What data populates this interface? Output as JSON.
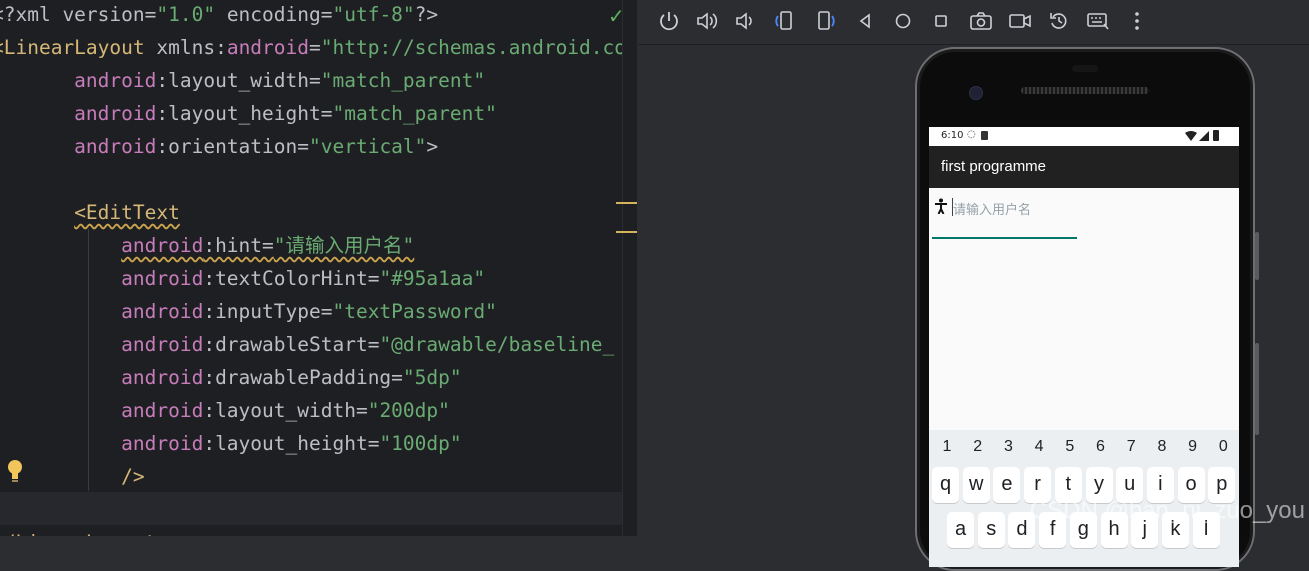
{
  "editor": {
    "lines": [
      [
        {
          "t": "<?xml version=",
          "c": "plain"
        },
        {
          "t": "\"1.0\"",
          "c": "str"
        },
        {
          "t": " encoding=",
          "c": "plain"
        },
        {
          "t": "\"utf-8\"",
          "c": "str"
        },
        {
          "t": "?>",
          "c": "plain"
        }
      ],
      [
        {
          "t": "<LinearLayout ",
          "c": "tag"
        },
        {
          "t": "xmlns:",
          "c": "plain"
        },
        {
          "t": "android",
          "c": "ns"
        },
        {
          "t": "=",
          "c": "plain"
        },
        {
          "t": "\"http://schemas.android.com/apk/res/android\"",
          "c": "str"
        }
      ],
      [
        {
          "t": "       android",
          "c": "ns"
        },
        {
          "t": ":layout_width=",
          "c": "plain"
        },
        {
          "t": "\"match_parent\"",
          "c": "str"
        }
      ],
      [
        {
          "t": "       android",
          "c": "ns"
        },
        {
          "t": ":layout_height=",
          "c": "plain"
        },
        {
          "t": "\"match_parent\"",
          "c": "str"
        }
      ],
      [
        {
          "t": "       android",
          "c": "ns"
        },
        {
          "t": ":orientation=",
          "c": "plain"
        },
        {
          "t": "\"vertical\"",
          "c": "str"
        },
        {
          "t": ">",
          "c": "plain"
        }
      ],
      [
        {
          "t": "",
          "c": "plain"
        }
      ],
      [
        {
          "t": "       <EditText",
          "c": "tag",
          "w": true
        }
      ],
      [
        {
          "t": "           android",
          "c": "ns",
          "w": true
        },
        {
          "t": ":hint=",
          "c": "plain",
          "w": true
        },
        {
          "t": "\"请输入用户名\"",
          "c": "str",
          "w": true
        }
      ],
      [
        {
          "t": "           android",
          "c": "ns"
        },
        {
          "t": ":textColorHint=",
          "c": "plain"
        },
        {
          "t": "\"#95a1aa\"",
          "c": "str"
        }
      ],
      [
        {
          "t": "           android",
          "c": "ns"
        },
        {
          "t": ":inputType=",
          "c": "plain"
        },
        {
          "t": "\"textPassword\"",
          "c": "str"
        }
      ],
      [
        {
          "t": "           android",
          "c": "ns"
        },
        {
          "t": ":drawableStart=",
          "c": "plain"
        },
        {
          "t": "\"@drawable/baseline_",
          "c": "str"
        }
      ],
      [
        {
          "t": "           android",
          "c": "ns"
        },
        {
          "t": ":drawablePadding=",
          "c": "plain"
        },
        {
          "t": "\"5dp\"",
          "c": "str"
        }
      ],
      [
        {
          "t": "           android",
          "c": "ns"
        },
        {
          "t": ":layout_width=",
          "c": "plain"
        },
        {
          "t": "\"200dp\"",
          "c": "str"
        }
      ],
      [
        {
          "t": "           android",
          "c": "ns"
        },
        {
          "t": ":layout_height=",
          "c": "plain"
        },
        {
          "t": "\"100dp\"",
          "c": "str"
        }
      ],
      [
        {
          "t": "           />",
          "c": "tag"
        }
      ],
      [
        {
          "t": "",
          "c": "plain"
        }
      ],
      [
        {
          "t": "</LinearLayout>",
          "c": "tag"
        }
      ]
    ]
  },
  "toolbar": {
    "icons": [
      "power-icon",
      "volume-up-icon",
      "volume-down-icon",
      "rotate-left-icon",
      "rotate-right-icon",
      "back-icon",
      "home-icon",
      "overview-icon",
      "screenshot-icon",
      "screen-record-icon",
      "reset-icon",
      "keyboard-icon",
      "more-icon"
    ]
  },
  "device": {
    "status_time": "6:10",
    "app_title": "first programme",
    "hint": "请输入用户名",
    "hint_color": "#95a1aa",
    "accent": "#00796b"
  },
  "keyboard": {
    "numbers": [
      "1",
      "2",
      "3",
      "4",
      "5",
      "6",
      "7",
      "8",
      "9",
      "0"
    ],
    "row1": [
      "q",
      "w",
      "e",
      "r",
      "t",
      "y",
      "u",
      "i",
      "o",
      "p"
    ],
    "row2": [
      "a",
      "s",
      "d",
      "f",
      "g",
      "h",
      "j",
      "k",
      "l"
    ]
  },
  "watermark": "CSDN @ban_ni_zuo_you"
}
